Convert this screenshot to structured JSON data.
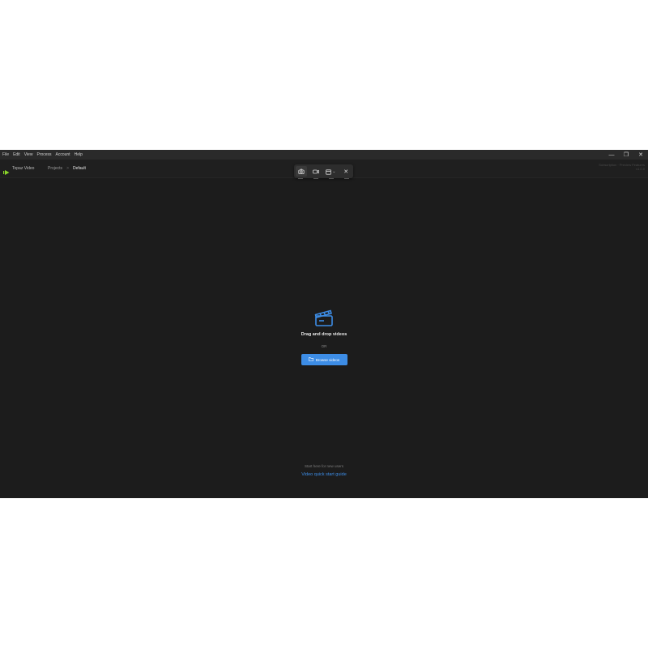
{
  "menu": {
    "items": [
      "File",
      "Edit",
      "View",
      "Process",
      "Account",
      "Help"
    ]
  },
  "window_controls": {
    "minimize": "—",
    "restore": "❐",
    "close": "✕"
  },
  "header": {
    "app_name": "Topaz Video",
    "breadcrumb": {
      "parent": "Projects",
      "separator": ">",
      "current": "Default"
    },
    "right_line1": "Subscription · Preview Features",
    "right_line2": "v1.0.0"
  },
  "toolbar": {
    "icons": [
      "camera-icon",
      "video-icon",
      "window-select-icon",
      "close-icon"
    ],
    "close_glyph": "✕",
    "window_caret": "⌄"
  },
  "empty_state": {
    "icon": "clapperboard-icon",
    "title": "Drag and drop videos",
    "or": "OR",
    "browse_label": "Browse videos"
  },
  "footer": {
    "hint": "Start here for new users",
    "link": "Video quick start guide"
  },
  "colors": {
    "accent": "#3d8de6",
    "background": "#1c1c1c",
    "logo_green": "#8bd62a"
  }
}
